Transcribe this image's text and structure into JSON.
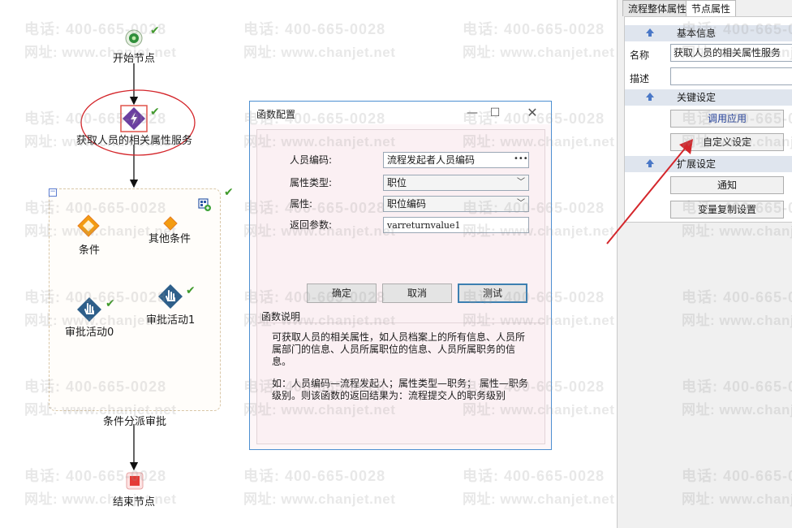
{
  "watermark": {
    "phone": "电话: 400-665-0028",
    "site": "网址: www.chanjet.net"
  },
  "flow": {
    "start_label": "开始节点",
    "service_label": "获取人员的相关属性服务",
    "condition_label": "条件",
    "other_condition_label": "其他条件",
    "approve0_label": "审批活动0",
    "approve1_label": "审批活动1",
    "group_label": "条件分派审批",
    "end_label": "结束节点"
  },
  "dialog": {
    "title": "函数配置",
    "fields": {
      "person_code_label": "人员编码:",
      "person_code_value": "流程发起者人员编码",
      "attr_type_label": "属性类型:",
      "attr_type_value": "职位",
      "attr_label": "属性:",
      "attr_value": "职位编码",
      "return_label": "返回参数:",
      "return_value": "varreturnvalue1"
    },
    "buttons": {
      "ok": "确定",
      "cancel": "取消",
      "test": "测试"
    },
    "desc_title": "函数说明",
    "desc_p1": "可获取人员的相关属性，如人员档案上的所有信息、人员所属部门的信息、人员所属职位的信息、人员所属职务的信息。",
    "desc_p2": "如：人员编码—流程发起人；属性类型—职务； 属性—职务级别。则该函数的返回结果为：流程提交人的职务级别"
  },
  "right_panel": {
    "tabs": [
      "流程整体属性",
      "节点属性"
    ],
    "basic_info": "基本信息",
    "name_label": "名称",
    "name_value": "获取人员的相关属性服务",
    "desc_label": "描述",
    "key_settings": "关键设定",
    "call_app": "调用应用",
    "custom_settings": "自定义设定",
    "ext_settings": "扩展设定",
    "notify": "通知",
    "var_copy": "变量复制设置"
  },
  "colors": {
    "accent_blue": "#4d8fd1",
    "annotation_red": "#d4262b",
    "check_green": "#3f9a2a",
    "condition_orange": "#f39c12",
    "service_purple": "#6b3fa0",
    "end_red": "#e53935"
  }
}
